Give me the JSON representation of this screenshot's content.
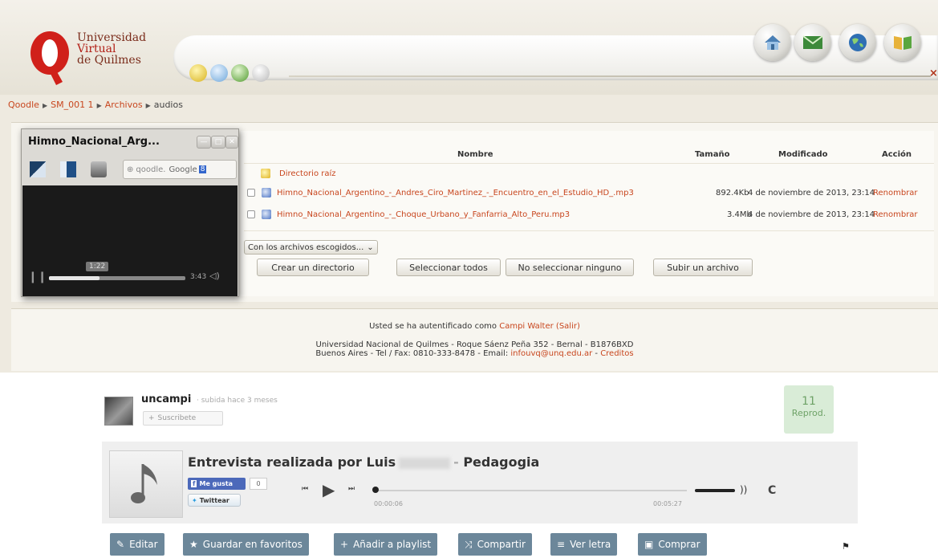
{
  "logo": {
    "line1": "Universidad",
    "line2": "Virtual",
    "line3": "de Quilmes"
  },
  "header": {
    "close_symbol": "×"
  },
  "breadcrumb": {
    "items": [
      "Qoodle",
      "SM_001 1",
      "Archivos",
      "audios"
    ]
  },
  "files": {
    "headers": {
      "name": "Nombre",
      "size": "Tamaño",
      "modified": "Modificado",
      "action": "Acción"
    },
    "root": "Directorio raíz",
    "rows": [
      {
        "name": "Himno_Nacional_Argentino_-_Andres_Ciro_Martinez_-_Encuentro_en_el_Estudio_HD_.mp3",
        "size": "892.4Kb",
        "modified": "4 de noviembre de 2013, 23:14",
        "action": "Renombrar"
      },
      {
        "name": "Himno_Nacional_Argentino_-_Choque_Urbano_y_Fanfarria_Alto_Peru.mp3",
        "size": "3.4Mb",
        "modified": "4 de noviembre de 2013, 23:14",
        "action": "Renombrar"
      }
    ],
    "with_selected": "Con los archivos escogidos...",
    "buttons": {
      "create_dir": "Crear un directorio",
      "select_all": "Seleccionar todos",
      "select_none": "No seleccionar ninguno",
      "upload": "Subir un archivo"
    }
  },
  "footer": {
    "auth_prefix": "Usted se ha autentificado como ",
    "user": "Campi Walter",
    "logout": "(Salir)",
    "address1": "Universidad Nacional de Quilmes - Roque Sáenz Peña 352 - Bernal - B1876BXD",
    "address2_prefix": "Buenos Aires - Tel / Fax: 0810-333-8478 - Email: ",
    "email": "infouvq@unq.edu.ar",
    "credits": "Creditos"
  },
  "player": {
    "title": "Himno_Nacional_Arg...",
    "search_text": "qoodle.",
    "search_engine": "Google",
    "time_tooltip": "1:22",
    "duration": "3:43",
    "progress": 0.37
  },
  "uploader": {
    "name": "uncampi",
    "uploaded": "· subida hace 3 meses",
    "subscribe": "Suscribete"
  },
  "plays": {
    "count": "11",
    "label": "Reprod."
  },
  "track": {
    "title_part1": "Entrevista realizada por Luis",
    "title_dash": "-",
    "title_part2": "Pedagogia",
    "like_label": "Me gusta",
    "like_count": "0",
    "tweet_label": "Twittear",
    "current_time": "00:00:06",
    "total_time": "00:05:27",
    "c_label": "C"
  },
  "actions": [
    "Editar",
    "Guardar en favoritos",
    "Añadir a playlist",
    "Compartir",
    "Ver letra",
    "Comprar"
  ],
  "colors": {
    "link": "#c8461e",
    "action_button": "#6c879a",
    "plays_bg": "#d9ecd7"
  }
}
